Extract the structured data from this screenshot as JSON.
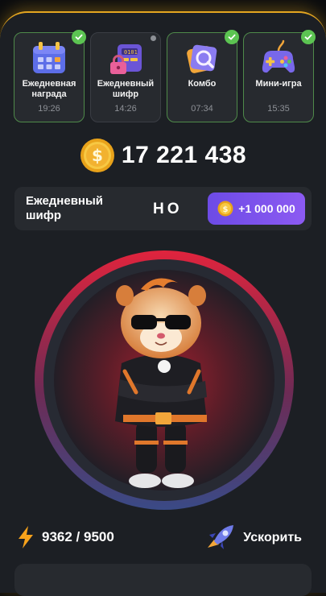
{
  "daily_cards": [
    {
      "title": "Ежедневная награда",
      "time": "19:26",
      "completed": true,
      "icon": "calendar-icon"
    },
    {
      "title": "Ежедневный шифр",
      "time": "14:26",
      "completed": false,
      "icon": "cipher-lock-icon"
    },
    {
      "title": "Комбо",
      "time": "07:34",
      "completed": true,
      "icon": "combo-icon"
    },
    {
      "title": "Мини-игра",
      "time": "15:35",
      "completed": true,
      "icon": "gamepad-icon"
    }
  ],
  "balance": {
    "amount": "17 221 438",
    "icon": "coin-icon"
  },
  "cipher": {
    "label": "Ежедневный шифр",
    "code": "НО",
    "reward": "+1 000 000"
  },
  "energy": {
    "value": "9362 / 9500",
    "icon": "lightning-icon"
  },
  "boost": {
    "label": "Ускорить",
    "icon": "rocket-icon"
  },
  "colors": {
    "accent": "#e3a520",
    "panel": "#1c1f24",
    "card": "#272a2f",
    "check": "#5cc452",
    "reward": "#7b52ec"
  }
}
